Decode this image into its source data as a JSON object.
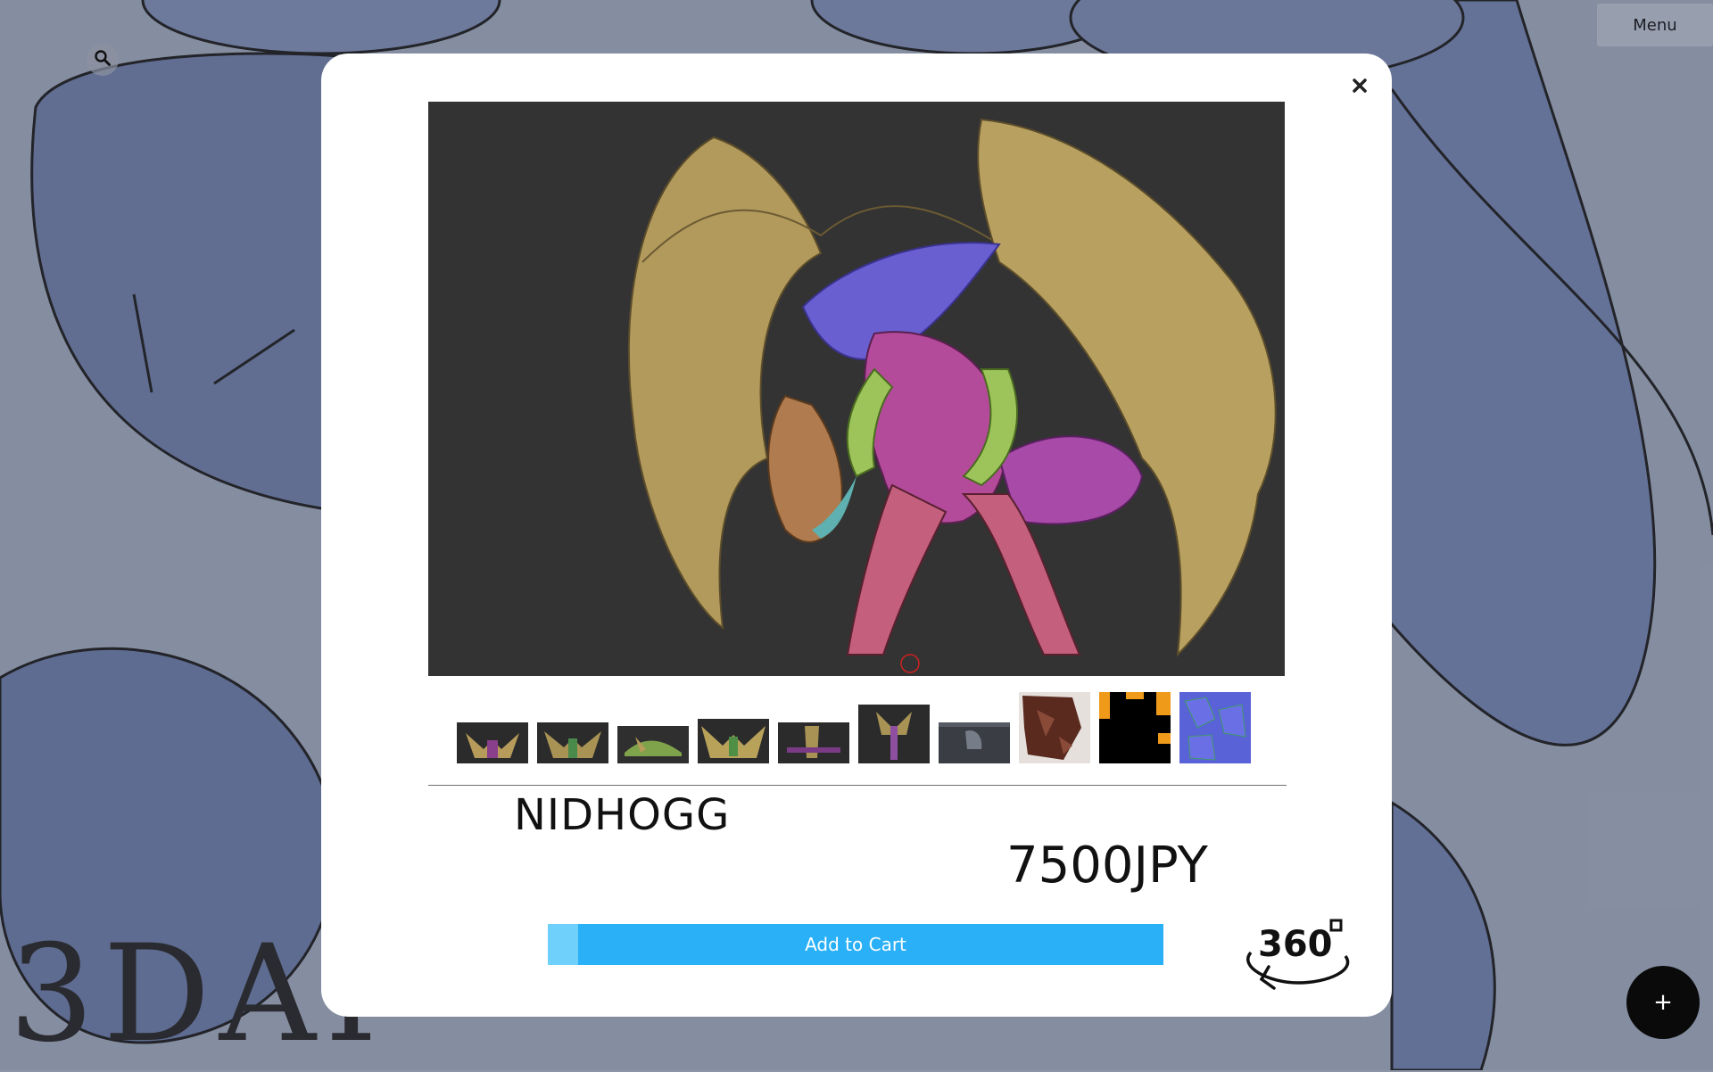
{
  "header": {
    "search_icon": "search-icon",
    "menu_label": "Menu"
  },
  "brand": {
    "logo_text": "3DAI"
  },
  "fab": {
    "icon": "plus-icon",
    "label": "+"
  },
  "modal": {
    "close_icon": "close-icon",
    "product": {
      "name": "NIDHOGG",
      "price": "7500JPY"
    },
    "cart_button_label": "Add to Cart",
    "view_360_label": "360",
    "thumbnails": [
      {
        "name": "thumb-front-view",
        "colors": [
          "#2b2b2b",
          "#b79b5a",
          "#8a3f8c"
        ]
      },
      {
        "name": "thumb-back-view",
        "colors": [
          "#2b2b2b",
          "#a89355",
          "#4a8a4a"
        ]
      },
      {
        "name": "thumb-side-view",
        "colors": [
          "#2f2f2f",
          "#7fa34a",
          "#b79b5a"
        ]
      },
      {
        "name": "thumb-wings-spread",
        "colors": [
          "#2b2b2b",
          "#b8a25a",
          "#4f8f45"
        ]
      },
      {
        "name": "thumb-profile",
        "colors": [
          "#2b2b2b",
          "#a89355",
          "#7a3a85"
        ]
      },
      {
        "name": "thumb-top-view",
        "colors": [
          "#2b2b2b",
          "#a89355",
          "#8e4fa0"
        ]
      },
      {
        "name": "thumb-wireframe",
        "colors": [
          "#3a3d44",
          "#777d88",
          "#555a63"
        ]
      },
      {
        "name": "thumb-texture-brown",
        "colors": [
          "#5a2a1e",
          "#8a4a38",
          "#e6e0dc"
        ]
      },
      {
        "name": "thumb-texture-orange",
        "colors": [
          "#000000",
          "#f09a1a",
          "#111111"
        ]
      },
      {
        "name": "thumb-texture-purple",
        "colors": [
          "#5a62d8",
          "#6b6fe6",
          "#3f9a6a"
        ]
      }
    ]
  },
  "colors": {
    "accent": "#29b0f7",
    "accent_light": "#6ed0fb",
    "viewer_background": "#333333"
  }
}
